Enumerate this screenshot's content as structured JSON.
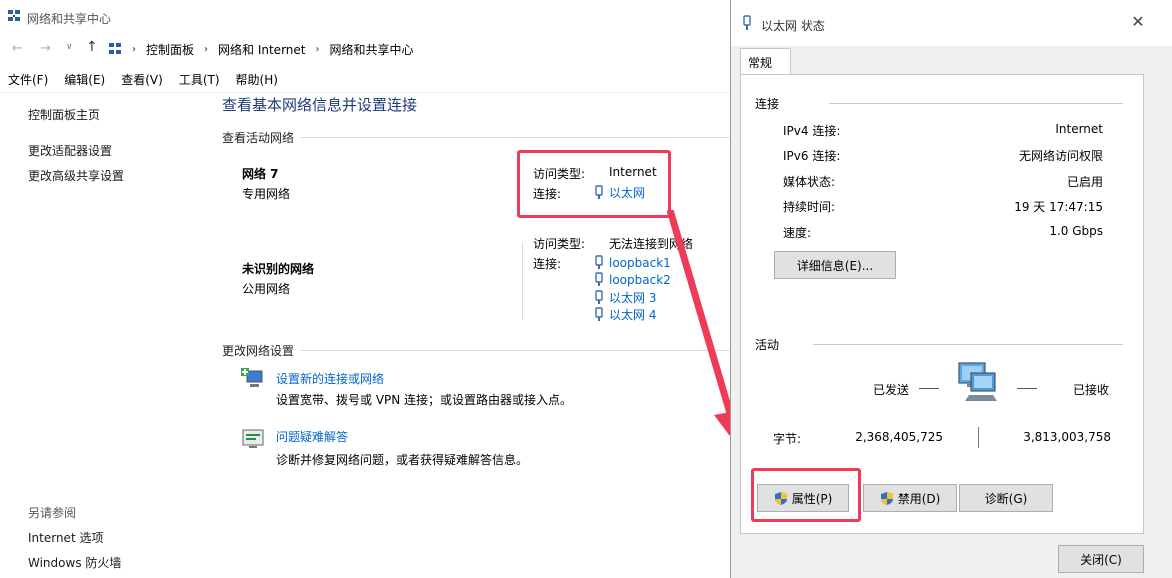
{
  "window": {
    "title": "网络和共享中心"
  },
  "breadcrumb": [
    "控制面板",
    "网络和 Internet",
    "网络和共享中心"
  ],
  "menu": [
    "文件(F)",
    "编辑(E)",
    "查看(V)",
    "工具(T)",
    "帮助(H)"
  ],
  "sidebar": {
    "links": [
      "控制面板主页",
      "更改适配器设置",
      "更改高级共享设置"
    ],
    "see_also_title": "另请参阅",
    "see_also": [
      "Internet 选项",
      "Windows 防火墙"
    ]
  },
  "main": {
    "heading": "查看基本网络信息并设置连接",
    "active_title": "查看活动网络",
    "networks": [
      {
        "name": "网络  7",
        "type": "专用网络",
        "access_label": "访问类型:",
        "access_value": "Internet",
        "conn_label": "连接:",
        "connections": [
          "以太网"
        ]
      },
      {
        "name": "未识别的网络",
        "type": "公用网络",
        "access_label": "访问类型:",
        "access_value": "无法连接到网络",
        "conn_label": "连接:",
        "connections": [
          "loopback1",
          "loopback2",
          "以太网 3",
          "以太网 4"
        ]
      }
    ],
    "change_title": "更改网络设置",
    "tasks": [
      {
        "link": "设置新的连接或网络",
        "desc": "设置宽带、拨号或 VPN 连接；或设置路由器或接入点。"
      },
      {
        "link": "问题疑难解答",
        "desc": "诊断并修复网络问题，或者获得疑难解答信息。"
      }
    ]
  },
  "dialog": {
    "title": "以太网 状态",
    "close_icon": "close-icon",
    "tab": "常规",
    "connection_group": "连接",
    "rows": [
      {
        "label": "IPv4 连接:",
        "value": "Internet"
      },
      {
        "label": "IPv6 连接:",
        "value": "无网络访问权限"
      },
      {
        "label": "媒体状态:",
        "value": "已启用"
      },
      {
        "label": "持续时间:",
        "value": "19 天 17:47:15"
      },
      {
        "label": "速度:",
        "value": "1.0 Gbps"
      }
    ],
    "details_button": "详细信息(E)...",
    "activity_group": "活动",
    "sent_label": "已发送",
    "received_label": "已接收",
    "bytes_label": "字节:",
    "bytes_sent": "2,368,405,725",
    "bytes_received": "3,813,003,758",
    "buttons": {
      "properties": "属性(P)",
      "disable": "禁用(D)",
      "diagnose": "诊断(G)",
      "close": "关闭(C)"
    }
  },
  "colors": {
    "accent_red": "#ef3b57",
    "link": "#0066cc",
    "heading": "#1e3c78"
  }
}
